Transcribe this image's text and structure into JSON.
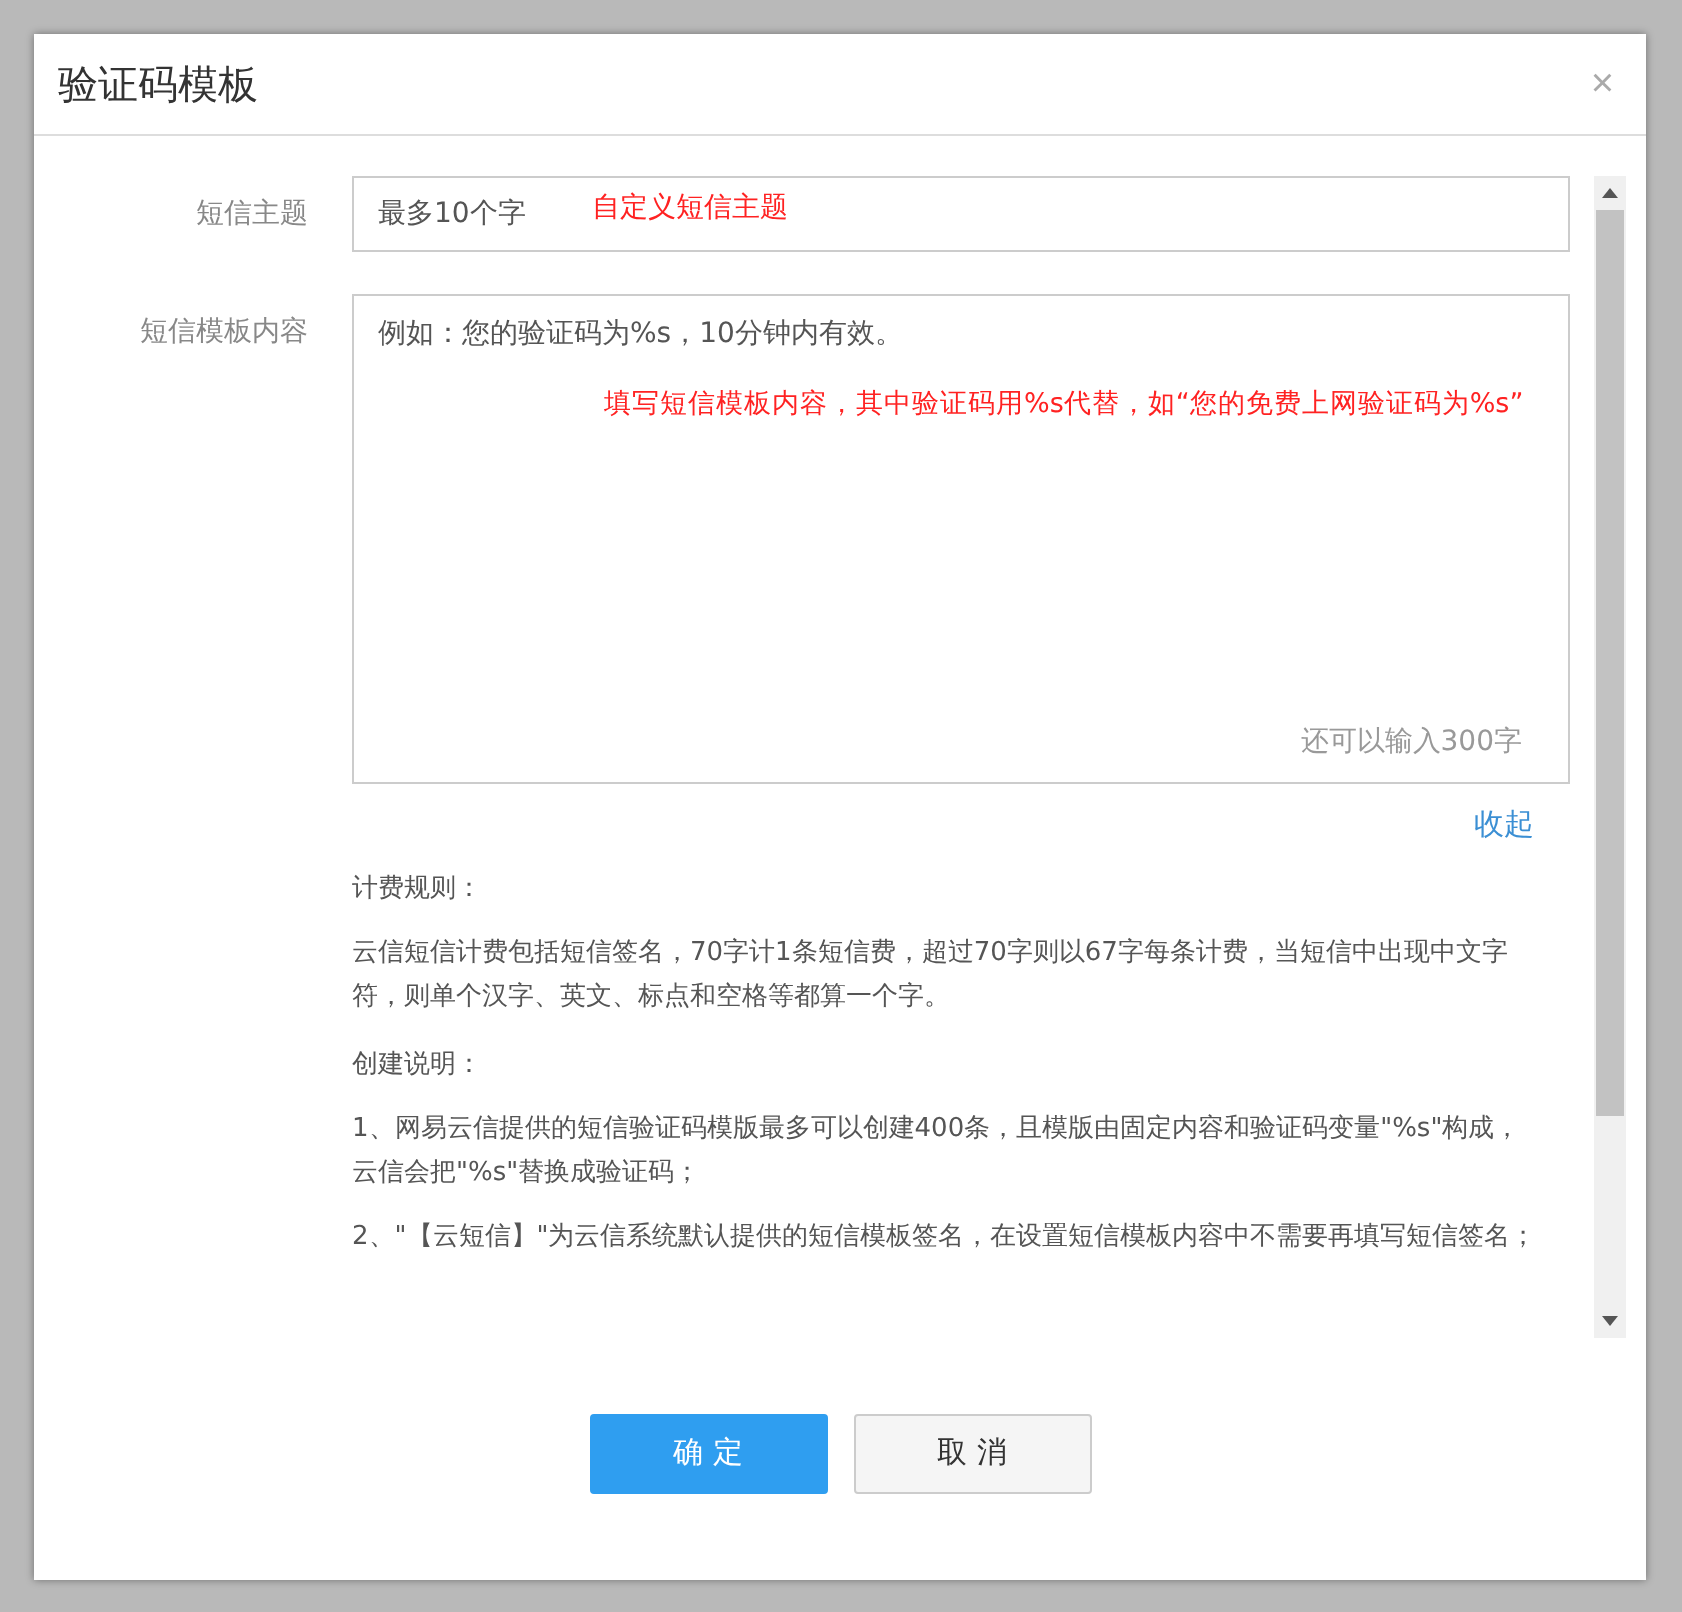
{
  "dialog": {
    "title": "验证码模板",
    "close": "×"
  },
  "fields": [
    {
      "kind": "input",
      "label": "短信主题",
      "placeholder": "最多10个字",
      "annotation": "自定义短信主题"
    },
    {
      "kind": "textarea",
      "label": "短信模板内容",
      "placeholder": "例如：您的验证码为%s，10分钟内有效。",
      "annotation": "填写短信模板内容，其中验证码用%s代替，如“您的免费上网验证码为%s”",
      "counter": "还可以输入300字"
    }
  ],
  "collapse_link": "收起",
  "sections": [
    {
      "heading": "计费规则：",
      "paragraphs": [
        "云信短信计费包括短信签名，70字计1条短信费，超过70字则以67字每条计费，当短信中出现中文字符，则单个汉字、英文、标点和空格等都算一个字。"
      ]
    },
    {
      "heading": "创建说明：",
      "paragraphs": [
        "1、网易云信提供的短信验证码模版最多可以创建400条，且模版由固定内容和验证码变量\"%s\"构成，云信会把\"%s\"替换成验证码；",
        "2、\"【云短信】\"为云信系统默认提供的短信模板签名，在设置短信模板内容中不需要再填写短信签名；"
      ]
    }
  ],
  "buttons": [
    {
      "label": "确 定",
      "kind": "primary"
    },
    {
      "label": "取 消",
      "kind": "default"
    }
  ]
}
